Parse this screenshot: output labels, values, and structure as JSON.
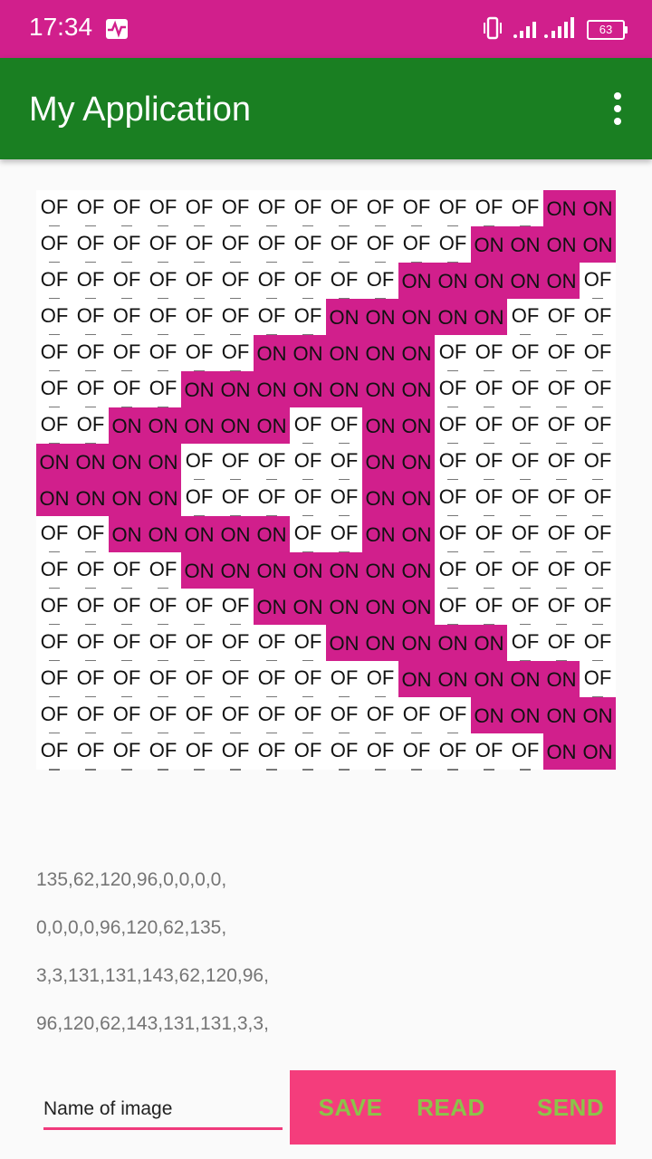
{
  "status_bar": {
    "time": "17:34",
    "battery": "63",
    "activity_icon": "activity-icon",
    "vibrate_icon": "vibrate-icon",
    "signal_icon": "signal-icon",
    "battery_icon": "battery-icon"
  },
  "app_bar": {
    "title": "My Application",
    "menu_icon": "overflow-menu-icon"
  },
  "grid": {
    "on_label": "ON",
    "off_label": "OF",
    "on_color": "#d11f8c",
    "off_color": "#ffffff",
    "rows": [
      "0000000000000011",
      "0000000000001111",
      "0000000000111110",
      "0000000011111000",
      "0000001111100000",
      "0000111111100000",
      "0011111001100000",
      "1111000001100000",
      "1111000001100000",
      "0011111001100000",
      "0000111111100000",
      "0000001111100000",
      "0000000011111000",
      "0000000000111110",
      "0000000000001111",
      "0000000000000011"
    ]
  },
  "hex_lines": [
    "135,62,120,96,0,0,0,0,",
    "0,0,0,0,96,120,62,135,",
    "3,3,131,131,143,62,120,96,",
    "96,120,62,143,131,131,3,3,"
  ],
  "name_input": {
    "placeholder": "Name of image",
    "value": ""
  },
  "buttons": {
    "save": "SAVE",
    "read": "READ",
    "send": "SEND"
  },
  "colors": {
    "status_bar": "#d11f8c",
    "app_bar": "#1a7f22",
    "button_panel": "#f43d7c",
    "button_text": "#8bc34a",
    "input_underline": "#f03a7c"
  }
}
